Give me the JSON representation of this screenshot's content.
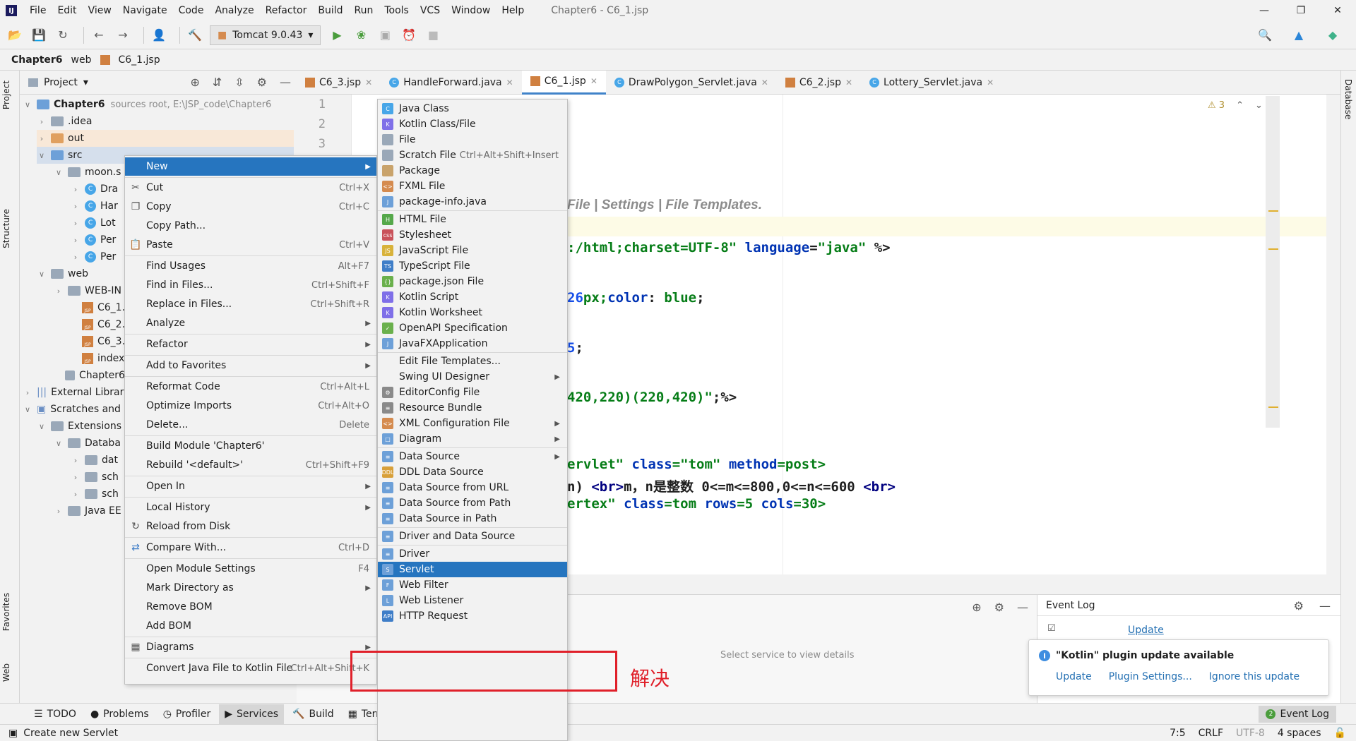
{
  "app": {
    "window_title": "Chapter6 - C6_1.jsp",
    "menu": [
      "File",
      "Edit",
      "View",
      "Navigate",
      "Code",
      "Analyze",
      "Refactor",
      "Build",
      "Run",
      "Tools",
      "VCS",
      "Window",
      "Help"
    ]
  },
  "toolbar": {
    "run_config": "Tomcat 9.0.43"
  },
  "breadcrumb": [
    "Chapter6",
    "web",
    "C6_1.jsp"
  ],
  "left_stripe": {
    "project": "Project",
    "structure": "Structure",
    "favorites": "Favorites",
    "web": "Web"
  },
  "right_stripe": {
    "database": "Database"
  },
  "project_panel": {
    "title": "Project",
    "tree": [
      {
        "label": "Chapter6",
        "suffix": "sources root,  E:\\JSP_code\\Chapter6"
      },
      {
        "label": ".idea"
      },
      {
        "label": "out"
      },
      {
        "label": "src"
      },
      {
        "label": "moon.s"
      },
      {
        "label": "Dra"
      },
      {
        "label": "Har"
      },
      {
        "label": "Lot"
      },
      {
        "label": "Per"
      },
      {
        "label": "Per"
      },
      {
        "label": "web"
      },
      {
        "label": "WEB-IN"
      },
      {
        "label": "C6_1.js"
      },
      {
        "label": "C6_2.js"
      },
      {
        "label": "C6_3.js"
      },
      {
        "label": "index.js"
      },
      {
        "label": "Chapter6.in"
      },
      {
        "label": "External Librarie"
      },
      {
        "label": "Scratches and C"
      },
      {
        "label": "Extensions"
      },
      {
        "label": "Databa"
      },
      {
        "label": "dat"
      },
      {
        "label": "sch"
      },
      {
        "label": "sch"
      },
      {
        "label": "Java EE"
      }
    ]
  },
  "tabs": [
    {
      "label": "C6_3.jsp",
      "kind": "jsp"
    },
    {
      "label": "HandleForward.java",
      "kind": "class"
    },
    {
      "label": "C6_1.jsp",
      "kind": "jsp",
      "active": true
    },
    {
      "label": "DrawPolygon_Servlet.java",
      "kind": "class"
    },
    {
      "label": "C6_2.jsp",
      "kind": "jsp"
    },
    {
      "label": "Lottery_Servlet.java",
      "kind": "class"
    }
  ],
  "editor": {
    "line_numbers": [
      "1",
      "2",
      "3"
    ],
    "warning_count": "3",
    "comment_text": "File | Settings | File Templates.",
    "code": {
      "l1a": ":/html;charset=UTF-8\"",
      "l1b": "language",
      "l1c": "=",
      "l1d": "\"java\"",
      "l1e": "%>",
      "l2a": "26",
      "l2b": "px;",
      "l2c": "color",
      "l2d": ": ",
      "l2e": "blue",
      "l2f": ";",
      "l3a": "5",
      "l3b": ";",
      "l4a": "420,220)(220,420)\"",
      "l4b": ";%>",
      "l5a": "ervlet\"",
      "l5b": "class",
      "l5c": "=\"tom\"",
      "l5d": "method",
      "l5e": "=post>",
      "l6a": "n)  ",
      "l6b": "<br>",
      "l6c": "m，n是整数 0<=m<=800,0<=n<=600 ",
      "l6d": "<br>",
      "l7a": "ertex\"",
      "l7b": "class",
      "l7c": "=tom",
      "l7d": "rows",
      "l7e": "=5",
      "l7f": "cols",
      "l7g": "=30>"
    }
  },
  "context_menu": {
    "items": [
      {
        "label": "New",
        "arrow": true,
        "selected": true
      },
      {
        "label": "Cut",
        "shortcut": "Ctrl+X",
        "icon": "cut-icon"
      },
      {
        "label": "Copy",
        "shortcut": "Ctrl+C",
        "icon": "copy-icon"
      },
      {
        "label": "Copy Path..."
      },
      {
        "label": "Paste",
        "shortcut": "Ctrl+V",
        "icon": "paste-icon"
      },
      {
        "label": "Find Usages",
        "shortcut": "Alt+F7"
      },
      {
        "label": "Find in Files...",
        "shortcut": "Ctrl+Shift+F"
      },
      {
        "label": "Replace in Files...",
        "shortcut": "Ctrl+Shift+R"
      },
      {
        "label": "Analyze",
        "arrow": true
      },
      {
        "label": "Refactor",
        "arrow": true
      },
      {
        "label": "Add to Favorites",
        "arrow": true
      },
      {
        "label": "Reformat Code",
        "shortcut": "Ctrl+Alt+L"
      },
      {
        "label": "Optimize Imports",
        "shortcut": "Ctrl+Alt+O"
      },
      {
        "label": "Delete...",
        "shortcut": "Delete"
      },
      {
        "label": "Build Module 'Chapter6'"
      },
      {
        "label": "Rebuild '<default>'",
        "shortcut": "Ctrl+Shift+F9"
      },
      {
        "label": "Open In",
        "arrow": true
      },
      {
        "label": "Local History",
        "arrow": true
      },
      {
        "label": "Reload from Disk",
        "icon": "reload-icon"
      },
      {
        "label": "Compare With...",
        "shortcut": "Ctrl+D",
        "icon": "compare-icon"
      },
      {
        "label": "Open Module Settings",
        "shortcut": "F4"
      },
      {
        "label": "Mark Directory as",
        "arrow": true
      },
      {
        "label": "Remove BOM"
      },
      {
        "label": "Add BOM"
      },
      {
        "label": "Diagrams",
        "arrow": true,
        "icon": "diagram-icon"
      },
      {
        "label": "Convert Java File to Kotlin File",
        "shortcut": "Ctrl+Alt+Shift+K"
      }
    ]
  },
  "submenu": {
    "items": [
      {
        "label": "Java Class",
        "icon": "java-class-icon",
        "color": "#47a6e8",
        "glyph": "C"
      },
      {
        "label": "Kotlin Class/File",
        "icon": "kotlin-icon",
        "color": "#7f6fe8",
        "glyph": "K"
      },
      {
        "label": "File",
        "icon": "file-icon",
        "color": "#9aa8b8",
        "glyph": ""
      },
      {
        "label": "Scratch File",
        "shortcut": "Ctrl+Alt+Shift+Insert",
        "icon": "scratch-file-icon",
        "color": "#9aa8b8",
        "glyph": ""
      },
      {
        "label": "Package",
        "icon": "package-icon",
        "color": "#c9a36b",
        "glyph": ""
      },
      {
        "label": "FXML File",
        "icon": "fxml-icon",
        "color": "#d58b4f",
        "glyph": "<>"
      },
      {
        "label": "package-info.java",
        "icon": "package-info-icon",
        "color": "#6da0d8",
        "glyph": "J"
      },
      {
        "label": "HTML File",
        "icon": "html-icon",
        "color": "#55a84a",
        "glyph": "H"
      },
      {
        "label": "Stylesheet",
        "icon": "css-icon",
        "color": "#c9525a",
        "glyph": "css"
      },
      {
        "label": "JavaScript File",
        "icon": "javascript-icon",
        "color": "#d8b23a",
        "glyph": "JS"
      },
      {
        "label": "TypeScript File",
        "icon": "typescript-icon",
        "color": "#3f7ec8",
        "glyph": "TS"
      },
      {
        "label": "package.json File",
        "icon": "package-json-icon",
        "color": "#6ab04c",
        "glyph": "{}"
      },
      {
        "label": "Kotlin Script",
        "icon": "kotlin-script-icon",
        "color": "#7f6fe8",
        "glyph": "K"
      },
      {
        "label": "Kotlin Worksheet",
        "icon": "kotlin-worksheet-icon",
        "color": "#7f6fe8",
        "glyph": "K"
      },
      {
        "label": "OpenAPI Specification",
        "icon": "openapi-icon",
        "color": "#6ab04c",
        "glyph": "✓"
      },
      {
        "label": "JavaFXApplication",
        "icon": "javafx-icon",
        "color": "#6da0d8",
        "glyph": "J"
      },
      {
        "label": "Edit File Templates..."
      },
      {
        "label": "Swing UI Designer",
        "arrow": true
      },
      {
        "label": "EditorConfig File",
        "icon": "editorconfig-icon",
        "color": "#8a8a8a",
        "glyph": "⚙"
      },
      {
        "label": "Resource Bundle",
        "icon": "resource-bundle-icon",
        "color": "#8a8a8a",
        "glyph": "≡"
      },
      {
        "label": "XML Configuration File",
        "arrow": true,
        "icon": "xml-icon",
        "color": "#d58b4f",
        "glyph": "<>"
      },
      {
        "label": "Diagram",
        "arrow": true,
        "icon": "diagram-icon",
        "color": "#6da0d8",
        "glyph": "□"
      },
      {
        "label": "Data Source",
        "arrow": true,
        "icon": "datasource-icon",
        "color": "#6da0d8",
        "glyph": "≡"
      },
      {
        "label": "DDL Data Source",
        "icon": "ddl-icon",
        "color": "#d8a03a",
        "glyph": "DDL"
      },
      {
        "label": "Data Source from URL",
        "icon": "datasource-url-icon",
        "color": "#6da0d8",
        "glyph": "≡"
      },
      {
        "label": "Data Source from Path",
        "icon": "datasource-path-icon",
        "color": "#6da0d8",
        "glyph": "≡"
      },
      {
        "label": "Data Source in Path",
        "icon": "datasource-in-path-icon",
        "color": "#6da0d8",
        "glyph": "≡"
      },
      {
        "label": "Driver and Data Source",
        "icon": "driver-datasource-icon",
        "color": "#6da0d8",
        "glyph": "≡"
      },
      {
        "label": "Driver",
        "icon": "driver-icon",
        "color": "#6da0d8",
        "glyph": "≡"
      },
      {
        "label": "Servlet",
        "icon": "servlet-icon",
        "color": "#6da0d8",
        "glyph": "S",
        "selected": true
      },
      {
        "label": "Web Filter",
        "icon": "web-filter-icon",
        "color": "#6da0d8",
        "glyph": "F"
      },
      {
        "label": "Web Listener",
        "icon": "web-listener-icon",
        "color": "#6da0d8",
        "glyph": "L"
      },
      {
        "label": "HTTP Request",
        "icon": "http-request-icon",
        "color": "#3f7ec8",
        "glyph": "API"
      }
    ]
  },
  "annotation": {
    "label": "解决",
    "color": "#e0202a"
  },
  "services": {
    "placeholder": "Select service to view details"
  },
  "event_log": {
    "title": "Event Log",
    "update_link": "Update",
    "notification": {
      "title": "\"Kotlin\" plugin update available",
      "actions": [
        "Update",
        "Plugin Settings...",
        "Ignore this update"
      ]
    }
  },
  "tool_windows": [
    "TODO",
    "Problems",
    "Profiler",
    "Services",
    "Build",
    "Terminal"
  ],
  "event_log_button": {
    "count": "2",
    "label": "Event Log"
  },
  "status_bar": {
    "message": "Create new Servlet",
    "position": "7:5",
    "line_sep": "CRLF",
    "encoding": "UTF-8",
    "indent": "4 spaces"
  }
}
